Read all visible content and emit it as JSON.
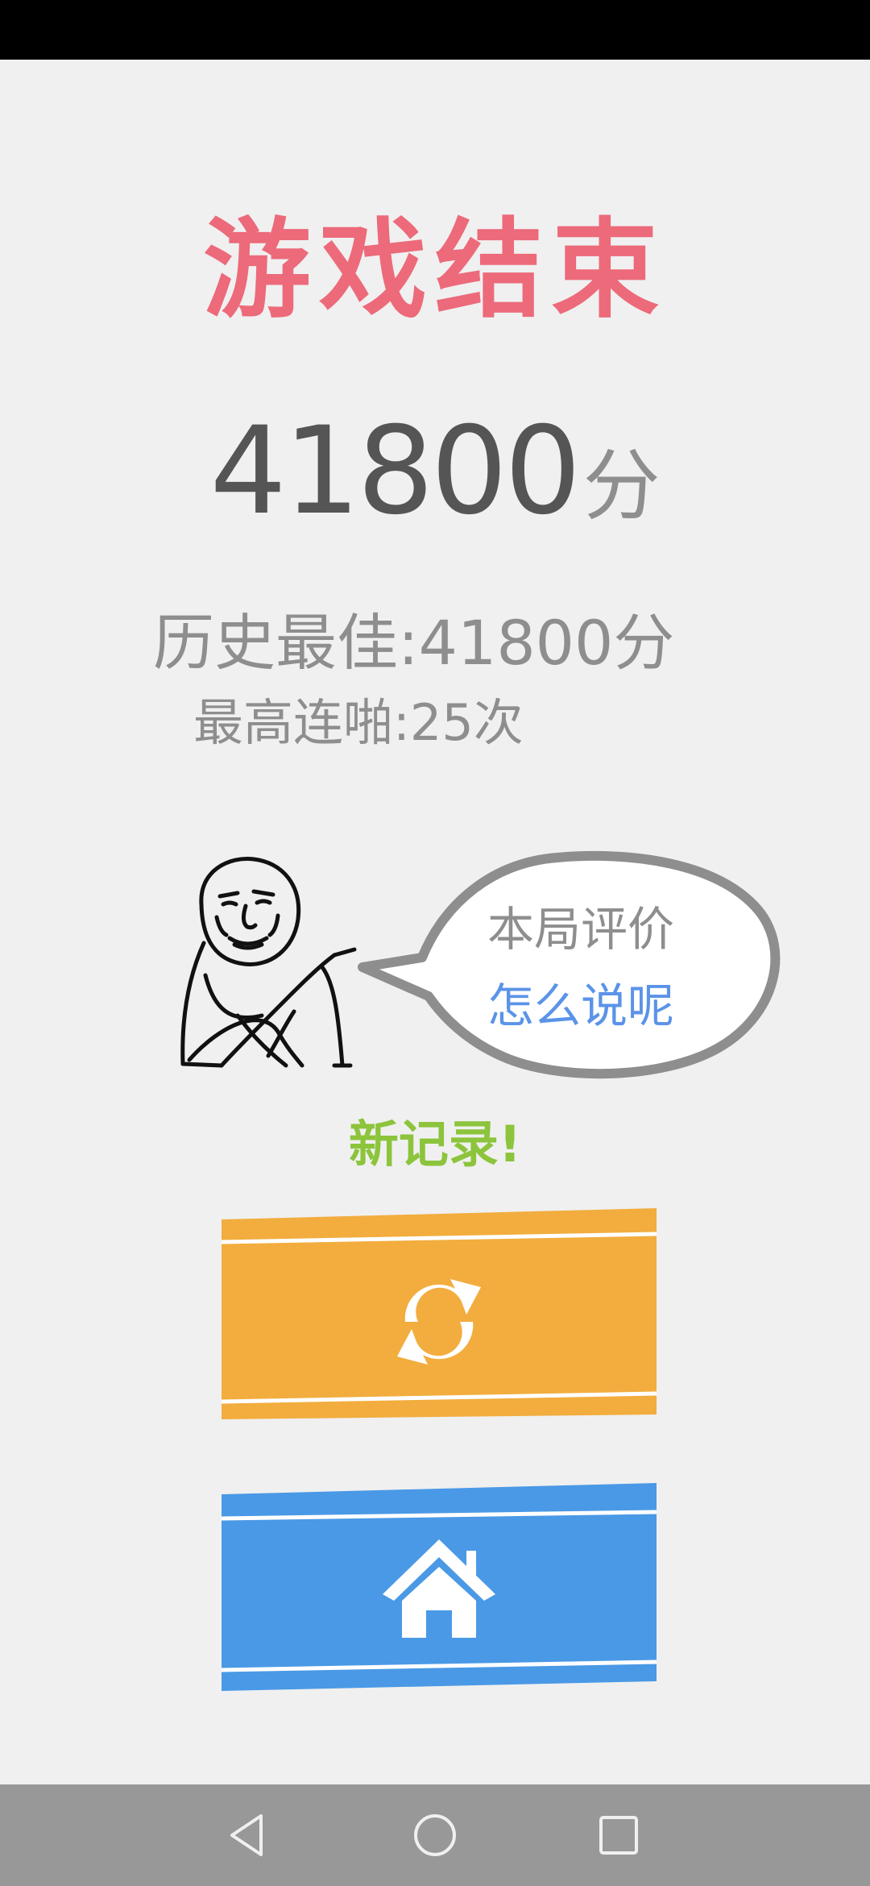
{
  "header": {
    "title": "游戏结束"
  },
  "score": {
    "value": "41800",
    "unit": "分"
  },
  "stats": {
    "best_label": "历史最佳:",
    "best_value": "41800分",
    "combo_label": "最高连啪:",
    "combo_value": "25次"
  },
  "bubble": {
    "line1": "本局评价",
    "line2": "怎么说呢"
  },
  "record": {
    "text": "新记录!"
  },
  "buttons": {
    "restart_icon": "refresh-icon",
    "home_icon": "home-icon"
  },
  "colors": {
    "title": "#ec6a7a",
    "score": "#555555",
    "muted": "#8e8e8e",
    "comment": "#5b93e8",
    "record": "#8cc43c",
    "restart_button": "#f2ad3e",
    "home_button": "#4a99e6"
  },
  "nav": {
    "back_icon": "triangle-back-icon",
    "home_icon": "circle-home-icon",
    "recents_icon": "square-recents-icon"
  }
}
